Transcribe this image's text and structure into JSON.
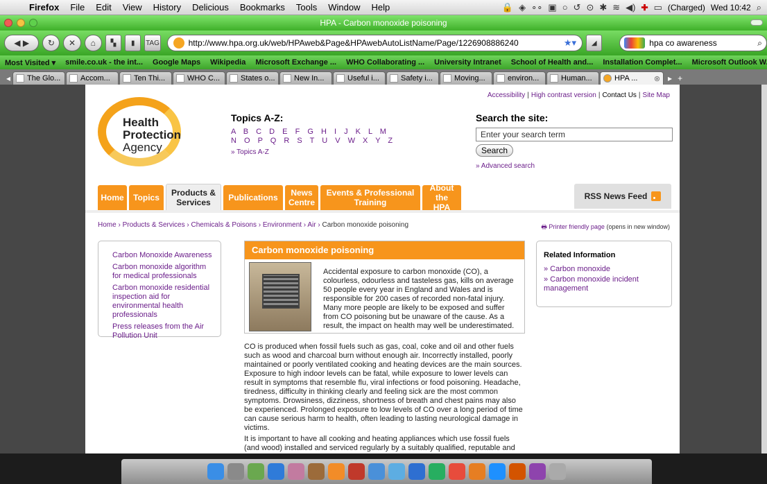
{
  "menubar": {
    "app": "Firefox",
    "items": [
      "File",
      "Edit",
      "View",
      "History",
      "Delicious",
      "Bookmarks",
      "Tools",
      "Window",
      "Help"
    ],
    "battery": "(Charged)",
    "clock": "Wed 10:42"
  },
  "window": {
    "title": "HPA - Carbon monoxide poisoning"
  },
  "navbar": {
    "url": "http://www.hpa.org.uk/web/HPAweb&Page&HPAwebAutoListName/Page/1226908886240",
    "search_value": "hpa co awareness"
  },
  "bookmarks": [
    "Most Visited ▾",
    "smile.co.uk - the int...",
    "Google Maps",
    "Wikipedia",
    "Microsoft Exchange ...",
    "WHO Collaborating ...",
    "University Intranet",
    "School of Health and...",
    "Installation Complet...",
    "Microsoft Outlook W..."
  ],
  "tabs": [
    "The Glo...",
    "Accom...",
    "Ten Thi...",
    "WHO C...",
    "States o...",
    "New In...",
    "Useful i...",
    "Safety i...",
    "Moving...",
    "environ...",
    "Human...",
    "HPA ..."
  ],
  "page": {
    "toplinks": [
      "Accessibility",
      "High contrast version",
      "Contact Us",
      "Site Map"
    ],
    "logo": {
      "line1": "Health",
      "line2": "Protection",
      "line3": "Agency"
    },
    "topics": {
      "heading": "Topics A-Z:",
      "row1": "A B C D E F G H I J K L M",
      "row2": "N O P Q R S T U V W X Y Z",
      "link": "» Topics A-Z"
    },
    "search": {
      "heading": "Search the site:",
      "placeholder": "Enter your search term",
      "button": "Search",
      "advanced": "» Advanced search"
    },
    "nav": [
      {
        "l1": "Home",
        "l2": ""
      },
      {
        "l1": "Topics",
        "l2": ""
      },
      {
        "l1": "Products &",
        "l2": "Services"
      },
      {
        "l1": "Publications",
        "l2": ""
      },
      {
        "l1": "News",
        "l2": "Centre"
      },
      {
        "l1": "Events & Professional",
        "l2": "Training"
      },
      {
        "l1": "About",
        "l2": "the HPA"
      }
    ],
    "rss": "RSS News Feed",
    "breadcrumb": [
      "Home",
      "Products & Services",
      "Chemicals & Poisons",
      "Environment",
      "Air",
      "Carbon monoxide poisoning"
    ],
    "printer": {
      "link": "Printer friendly page",
      "note": "(opens in new window)"
    },
    "left_links": [
      "Carbon Monoxide Awareness",
      "Carbon monoxide algorithm for medical professionals",
      "Carbon monoxide residential inspection aid for environmental health professionals",
      "Press releases from the Air Pollution Unit"
    ],
    "feature": {
      "title": "Carbon monoxide poisoning",
      "text": "Accidental exposure to carbon monoxide (CO), a colourless, odourless and tasteless gas, kills on average 50 people every year in England and Wales and is responsible for 200 cases of recorded non-fatal injury. Many more people are likely to be exposed and suffer from CO poisoning but be unaware of the cause. As a result, the impact on health may well be underestimated."
    },
    "body1": "CO is produced when fossil fuels such as gas, coal, coke and oil and other fuels such as wood and charcoal burn without enough air. Incorrectly installed, poorly maintained or poorly ventilated cooking and heating devices are the main sources. Exposure to high indoor levels can be fatal, while exposure to lower levels can result in symptoms that resemble flu, viral infections or food poisoning. Headache, tiredness, difficulty in thinking clearly and feeling sick are the most common symptoms. Drowsiness, dizziness, shortness of breath and chest pains may also be experienced. Prolonged exposure to low levels of CO over a long period of time can cause serious harm to health, often leading to lasting neurological damage in victims.",
    "body2": "It is important to have all cooking and heating appliances which use fossil fuels (and wood) installed and serviced regularly by a suitably qualified, reputable and registered",
    "related": {
      "heading": "Related Information",
      "links": [
        "» Carbon monoxide",
        "» Carbon monoxide incident management"
      ]
    }
  },
  "colors": {
    "accent": "#f7951c",
    "link": "#6b1e8a",
    "chrome": "#4fbf3a"
  },
  "dock_icons": [
    "finder",
    "system-prefs",
    "photos",
    "safari",
    "preview",
    "address-book",
    "vlc",
    "itunes",
    "mail",
    "chat",
    "word",
    "excel",
    "ical",
    "firefox",
    "skype",
    "powerpoint",
    "onenote",
    "trash"
  ]
}
